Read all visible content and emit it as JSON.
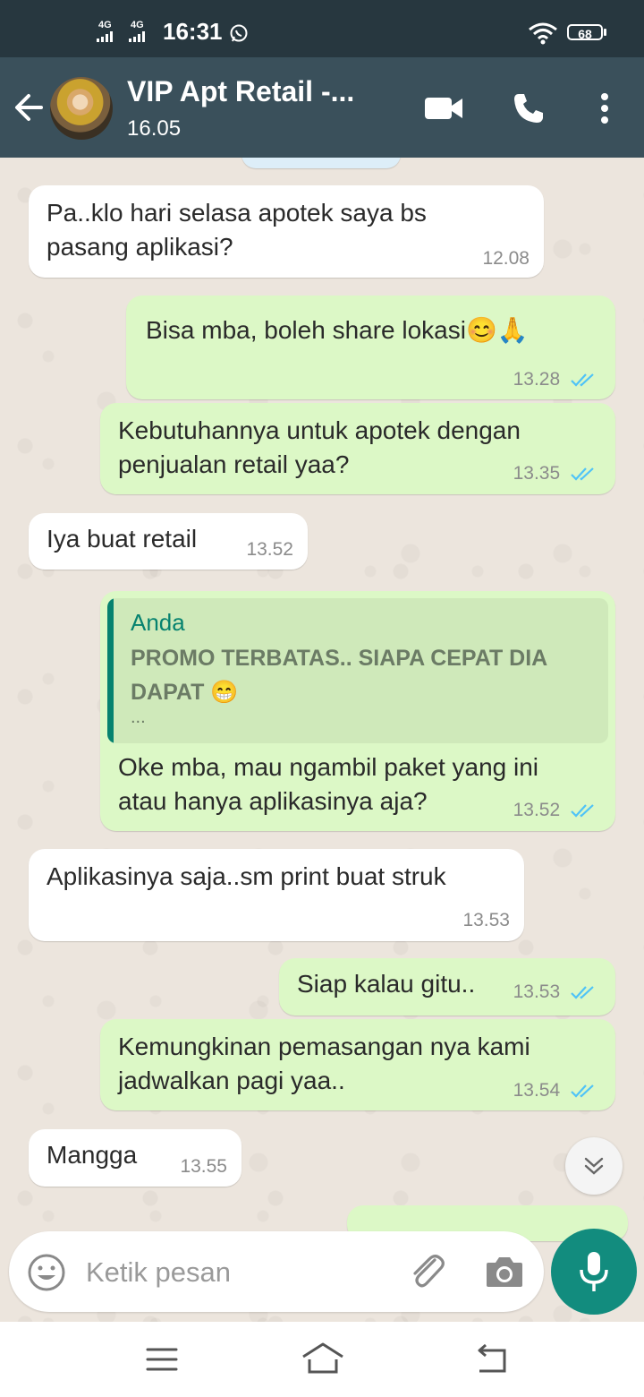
{
  "status_bar": {
    "network_1": "4G",
    "network_2": "4G",
    "time": "16:31",
    "battery": "68"
  },
  "header": {
    "title": "VIP Apt Retail -...",
    "subtitle": "16.05",
    "icons": [
      "back-arrow-icon",
      "video-call-icon",
      "phone-icon",
      "more-options-icon"
    ]
  },
  "messages": [
    {
      "dir": "in",
      "lines": [
        "Pa..klo hari selasa apotek saya bs",
        "pasang aplikasi?"
      ],
      "time": "12.08"
    },
    {
      "dir": "out",
      "text": "Bisa mba, boleh share lokasi😊🙏",
      "time": "13.28",
      "read": true
    },
    {
      "dir": "out",
      "lines": [
        "Kebutuhannya untuk apotek dengan",
        "penjualan retail yaa?"
      ],
      "time": "13.35",
      "read": true
    },
    {
      "dir": "in",
      "text": "Iya buat retail",
      "time": "13.52"
    },
    {
      "dir": "out",
      "quote": {
        "author": "Anda",
        "lines": [
          "PROMO TERBATAS.. SIAPA CEPAT DIA",
          "DAPAT 😁"
        ],
        "more": "..."
      },
      "lines": [
        "Oke mba, mau ngambil paket yang ini",
        "atau hanya aplikasinya aja?"
      ],
      "time": "13.52",
      "read": true
    },
    {
      "dir": "in",
      "text": "Aplikasinya saja..sm print buat struk",
      "time": "13.53"
    },
    {
      "dir": "out",
      "text": "Siap kalau gitu..",
      "time": "13.53",
      "read": true
    },
    {
      "dir": "out",
      "lines": [
        "Kemungkinan pemasangan nya kami",
        "jadwalkan pagi yaa.."
      ],
      "time": "13.54",
      "read": true
    },
    {
      "dir": "in",
      "text": "Mangga",
      "time": "13.55"
    }
  ],
  "input": {
    "placeholder": "Ketik pesan"
  },
  "colors": {
    "header": "#3A505B",
    "statusbar": "#27373F",
    "outgoing_bubble": "#DCF8C6",
    "incoming_bubble": "#FFFFFF",
    "chat_background": "#ECE5DD",
    "accent": "#128C7E",
    "read_ticks": "#4FC3F7"
  }
}
